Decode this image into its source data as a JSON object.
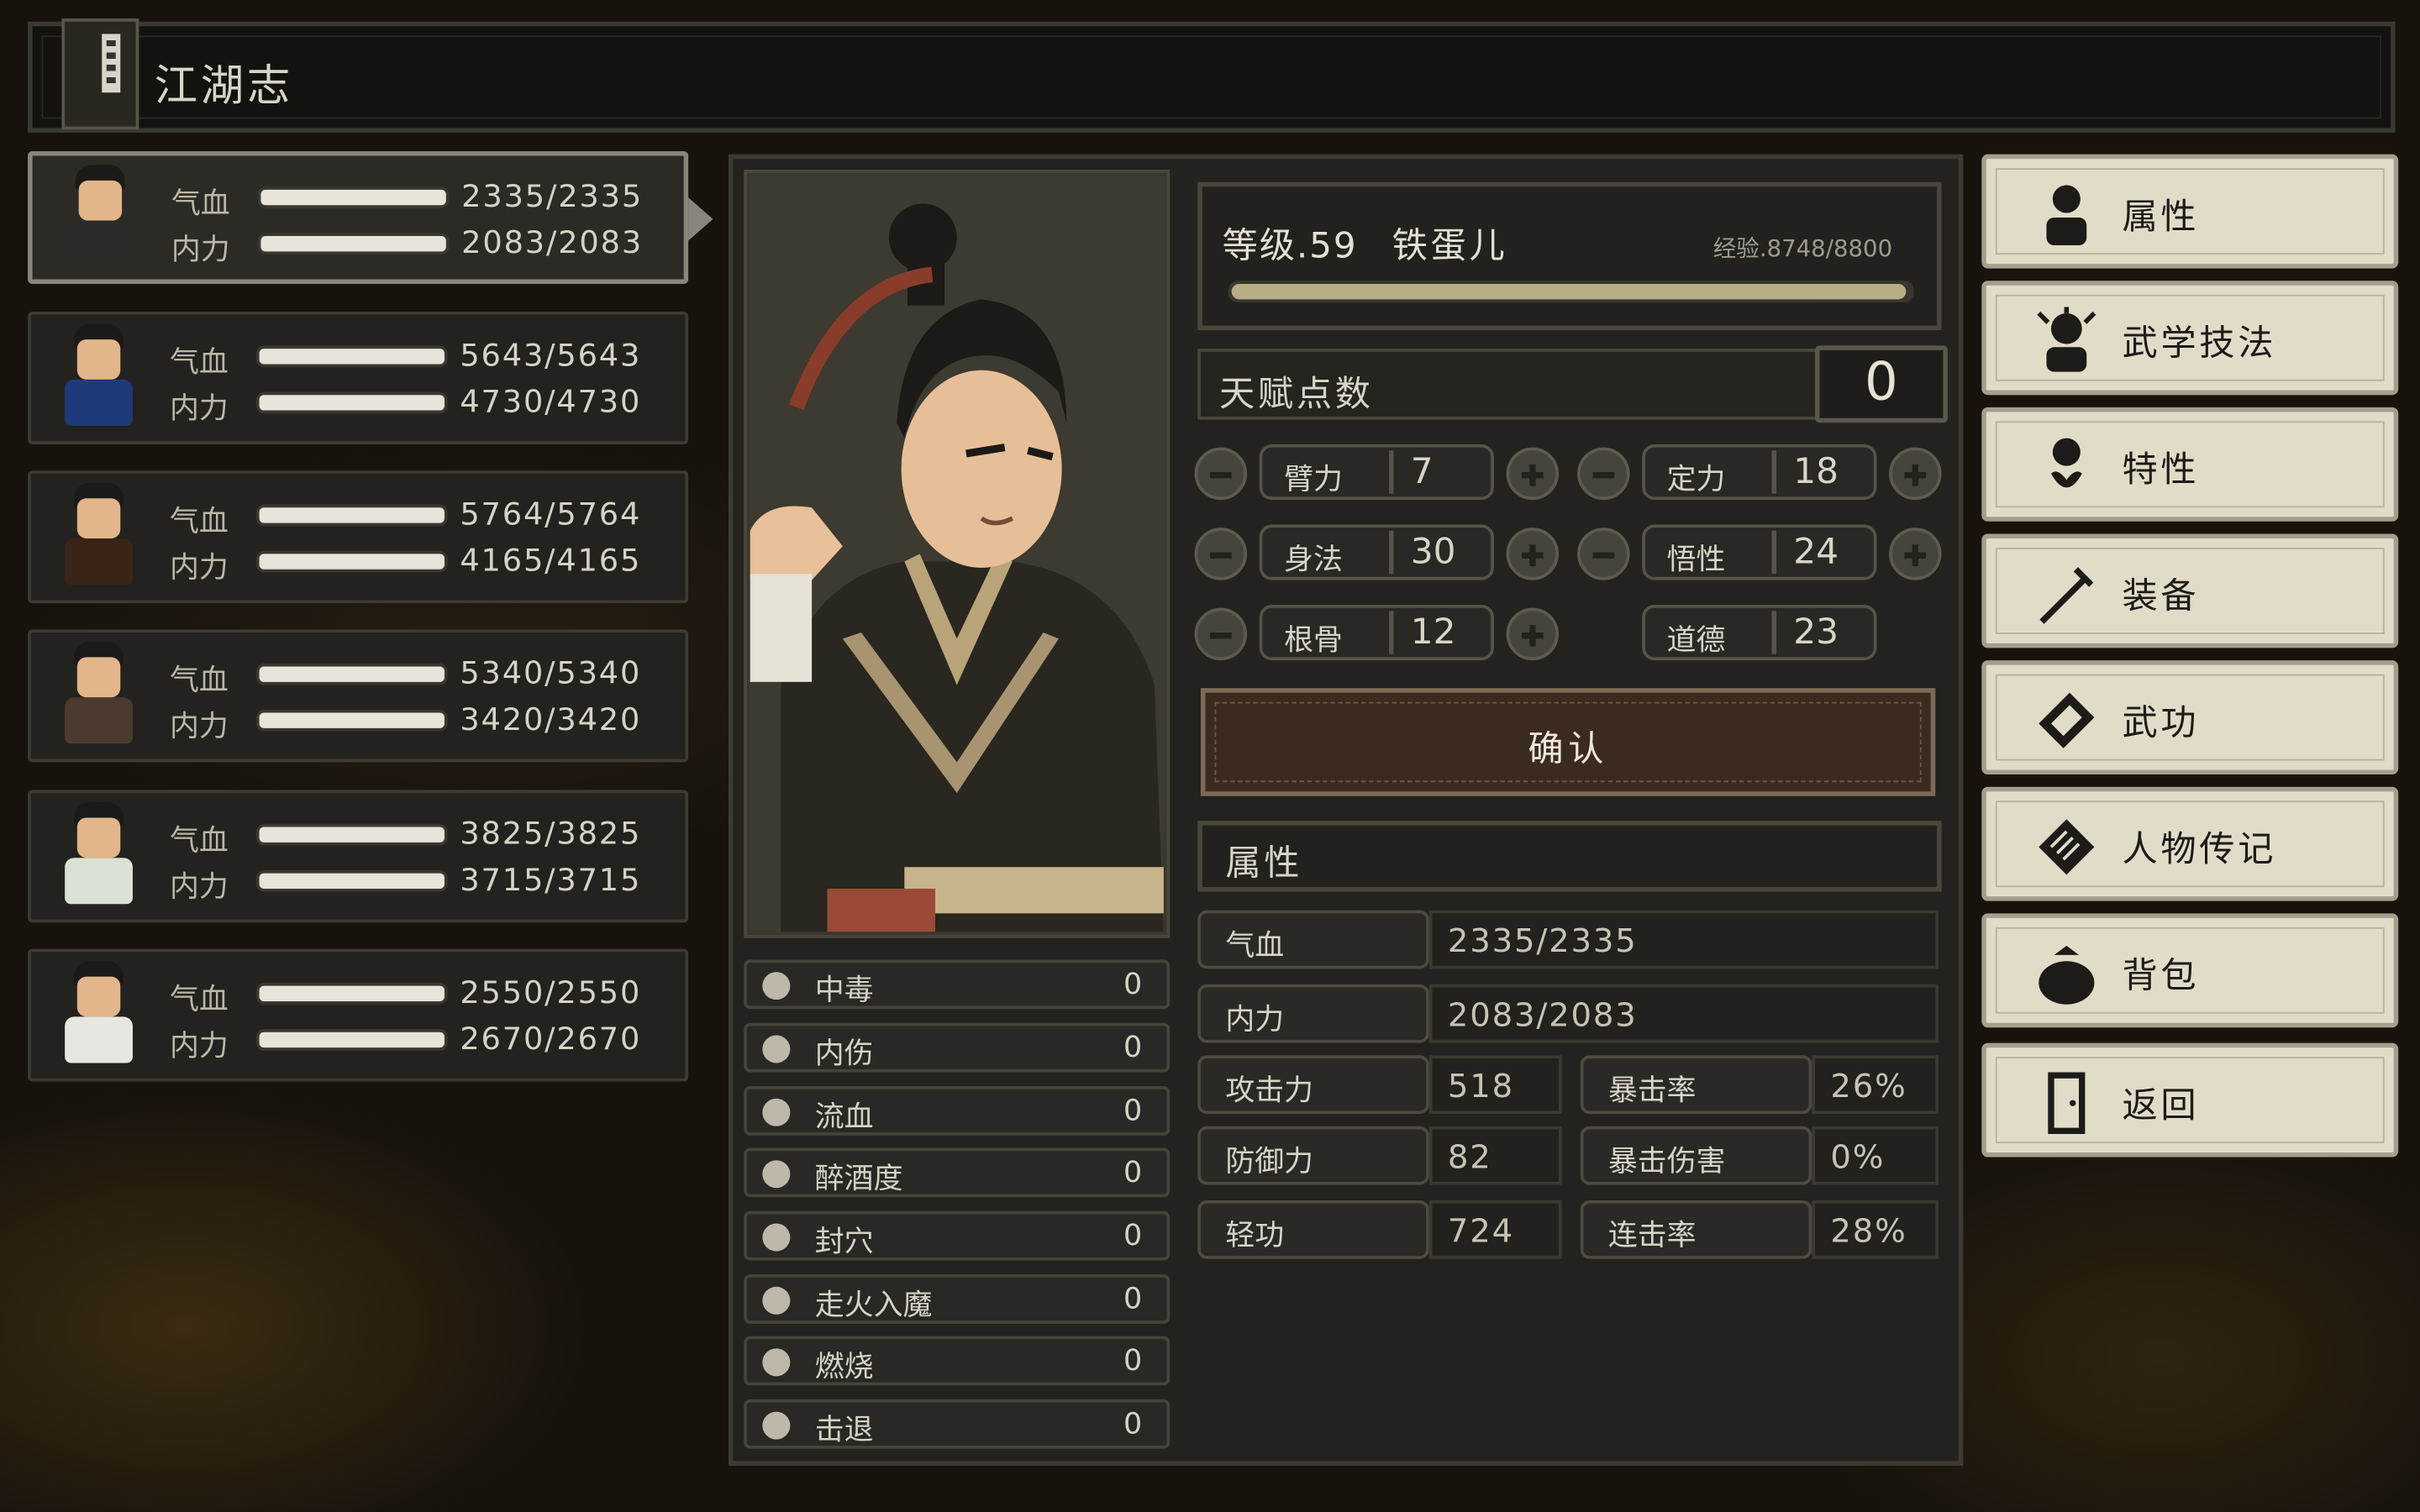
{
  "header": {
    "title": "江湖志"
  },
  "party": [
    {
      "hp_label": "气血",
      "mp_label": "内力",
      "hp": "2335/2335",
      "mp": "2083/2083",
      "hp_ratio": 1.0,
      "mp_ratio": 1.0,
      "active": true,
      "outfit_color": "#2b2a26"
    },
    {
      "hp_label": "气血",
      "mp_label": "内力",
      "hp": "5643/5643",
      "mp": "4730/4730",
      "hp_ratio": 1.0,
      "mp_ratio": 1.0,
      "active": false,
      "outfit_color": "#1f3a7a"
    },
    {
      "hp_label": "气血",
      "mp_label": "内力",
      "hp": "5764/5764",
      "mp": "4165/4165",
      "hp_ratio": 1.0,
      "mp_ratio": 1.0,
      "active": false,
      "outfit_color": "#3a2418"
    },
    {
      "hp_label": "气血",
      "mp_label": "内力",
      "hp": "5340/5340",
      "mp": "3420/3420",
      "hp_ratio": 1.0,
      "mp_ratio": 1.0,
      "active": false,
      "outfit_color": "#4a3a30"
    },
    {
      "hp_label": "气血",
      "mp_label": "内力",
      "hp": "3825/3825",
      "mp": "3715/3715",
      "hp_ratio": 1.0,
      "mp_ratio": 1.0,
      "active": false,
      "outfit_color": "#d9e2d4"
    },
    {
      "hp_label": "气血",
      "mp_label": "内力",
      "hp": "2550/2550",
      "mp": "2670/2670",
      "hp_ratio": 1.0,
      "mp_ratio": 1.0,
      "active": false,
      "outfit_color": "#e8e6e0"
    }
  ],
  "status_effects": [
    {
      "name": "中毒",
      "value": "0",
      "icon": "skull-icon"
    },
    {
      "name": "内伤",
      "value": "0",
      "icon": "broken-heart-icon"
    },
    {
      "name": "流血",
      "value": "0",
      "icon": "blood-splat-icon"
    },
    {
      "name": "醉酒度",
      "value": "0",
      "icon": "drunk-face-icon"
    },
    {
      "name": "封穴",
      "value": "0",
      "icon": "acupoint-icon"
    },
    {
      "name": "走火入魔",
      "value": "0",
      "icon": "demon-face-icon"
    },
    {
      "name": "燃烧",
      "value": "0",
      "icon": "flame-icon"
    },
    {
      "name": "击退",
      "value": "0",
      "icon": "boot-icon"
    }
  ],
  "character": {
    "level": "等级.59",
    "name": "铁蛋儿",
    "exp": "经验.8748/8800",
    "exp_ratio": 0.994
  },
  "talent": {
    "label": "天赋点数",
    "value": "0"
  },
  "attributes": [
    {
      "name": "臂力",
      "value": "7",
      "adjustable": true
    },
    {
      "name": "定力",
      "value": "18",
      "adjustable": true
    },
    {
      "name": "身法",
      "value": "30",
      "adjustable": true
    },
    {
      "name": "悟性",
      "value": "24",
      "adjustable": true
    },
    {
      "name": "根骨",
      "value": "12",
      "adjustable": true
    },
    {
      "name": "道德",
      "value": "23",
      "adjustable": false
    }
  ],
  "confirm_label": "确认",
  "stats": {
    "header": "属性",
    "hp": {
      "name": "气血",
      "value": "2335/2335"
    },
    "mp": {
      "name": "内力",
      "value": "2083/2083"
    },
    "attack": {
      "name": "攻击力",
      "value": "518"
    },
    "crit_rate": {
      "name": "暴击率",
      "value": "26%"
    },
    "defense": {
      "name": "防御力",
      "value": "82"
    },
    "crit_damage": {
      "name": "暴击伤害",
      "value": "0%"
    },
    "qinggong": {
      "name": "轻功",
      "value": "724"
    },
    "combo_rate": {
      "name": "连击率",
      "value": "28%"
    }
  },
  "menu": [
    {
      "label": "属性",
      "icon": "person-icon"
    },
    {
      "label": "武学技法",
      "icon": "martial-skill-icon"
    },
    {
      "label": "特性",
      "icon": "trait-icon"
    },
    {
      "label": "装备",
      "icon": "sword-icon"
    },
    {
      "label": "武功",
      "icon": "manual-book-icon"
    },
    {
      "label": "人物传记",
      "icon": "scroll-icon"
    },
    {
      "label": "背包",
      "icon": "bag-icon"
    },
    {
      "label": "返回",
      "icon": "door-icon"
    }
  ],
  "colors": {
    "panel_bg": "#24221e",
    "menu_bg": "#e0dcc8",
    "confirm_bg": "#3b2a20",
    "bar_fill": "#e8e4da",
    "exp_fill": "#b8ad85"
  }
}
